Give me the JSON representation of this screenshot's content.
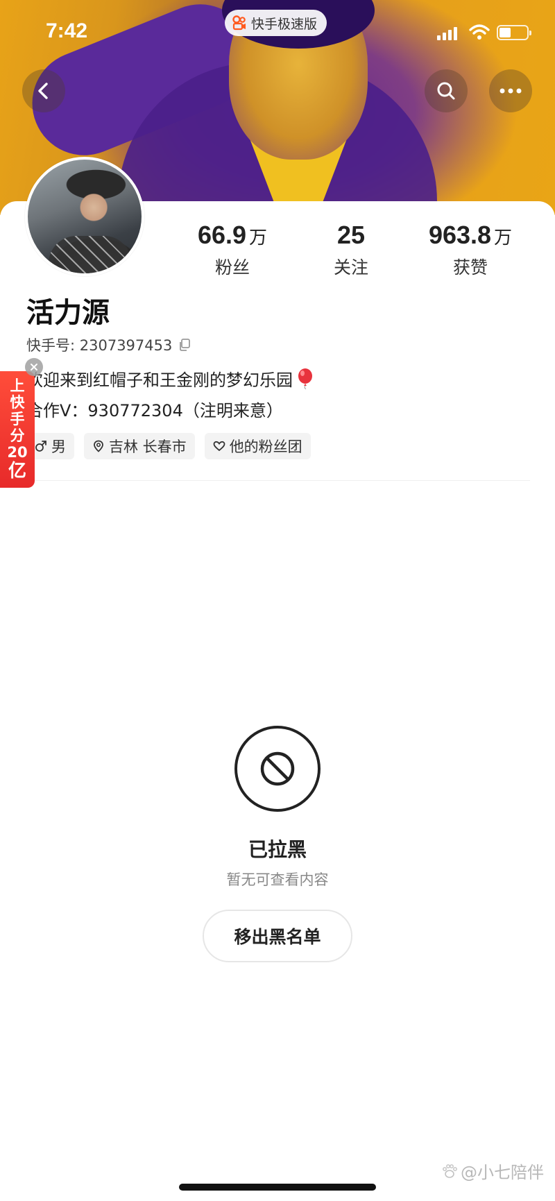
{
  "status_bar": {
    "time": "7:42",
    "app_name": "快手极速版"
  },
  "nav": {
    "back_icon": "chevron-left-icon",
    "search_icon": "search-icon",
    "more_icon": "more-dots-icon"
  },
  "profile": {
    "name": "活力源",
    "id_label": "快手号: 2307397453",
    "bio_line1": "欢迎来到红帽子和王金刚的梦幻乐园",
    "bio_line2": "合作V：930772304（注明来意）",
    "stats": [
      {
        "num": "66.9",
        "unit": "万",
        "label": "粉丝"
      },
      {
        "num": "25",
        "unit": "",
        "label": "关注"
      },
      {
        "num": "963.8",
        "unit": "万",
        "label": "获赞"
      }
    ],
    "tags": [
      {
        "icon": "male-icon",
        "text": "男"
      },
      {
        "icon": "location-pin-icon",
        "text": "吉林 长春市"
      },
      {
        "icon": "heart-group-icon",
        "text": "他的粉丝团"
      }
    ]
  },
  "promo": {
    "line1": "上",
    "line2": "快",
    "line3": "手",
    "line4": "分",
    "line5": "20",
    "line6": "亿"
  },
  "blocked": {
    "title": "已拉黑",
    "subtitle": "暂无可查看内容",
    "button": "移出黑名单"
  },
  "watermark": "@小七陪伴",
  "colors": {
    "banner_gold": "#e9a516",
    "banner_purple": "#5a2a9a",
    "promo_red": "#e72a2a"
  }
}
